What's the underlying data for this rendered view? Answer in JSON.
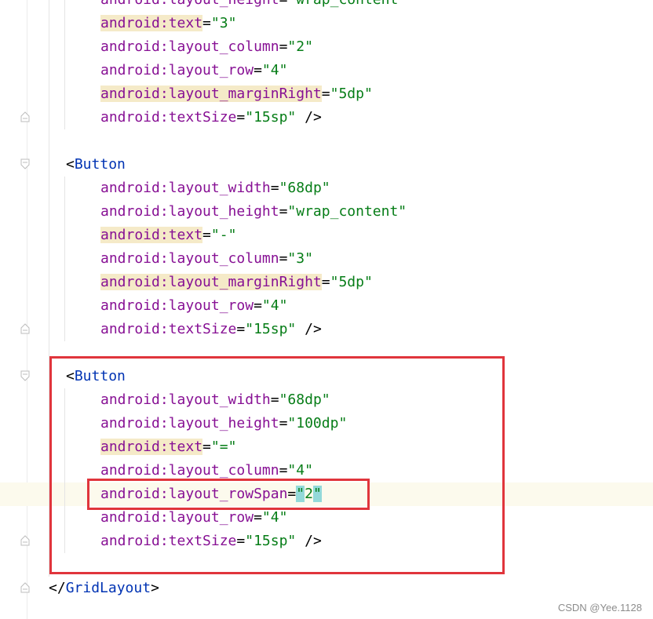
{
  "editor": {
    "lines": [
      {
        "attr": "android:layout_height",
        "val": "\"wrap_content\""
      },
      {
        "attr": "android:text",
        "val": "\"3\"",
        "hl": true
      },
      {
        "attr": "android:layout_column",
        "val": "\"2\""
      },
      {
        "attr": "android:layout_row",
        "val": "\"4\""
      },
      {
        "attr": "android:layout_marginRight",
        "val": "\"5dp\"",
        "hl": true
      },
      {
        "attr": "android:textSize",
        "val": "\"15sp\"",
        "end": " />"
      },
      {
        "tag": "Button"
      },
      {
        "attr": "android:layout_width",
        "val": "\"68dp\""
      },
      {
        "attr": "android:layout_height",
        "val": "\"wrap_content\""
      },
      {
        "attr": "android:text",
        "val": "\"-\"",
        "hl": true
      },
      {
        "attr": "android:layout_column",
        "val": "\"3\""
      },
      {
        "attr": "android:layout_marginRight",
        "val": "\"5dp\"",
        "hl": true
      },
      {
        "attr": "android:layout_row",
        "val": "\"4\""
      },
      {
        "attr": "android:textSize",
        "val": "\"15sp\"",
        "end": " />"
      },
      {
        "tag": "Button"
      },
      {
        "attr": "android:layout_width",
        "val": "\"68dp\""
      },
      {
        "attr": "android:layout_height",
        "val": "\"100dp\""
      },
      {
        "attr": "android:text",
        "val": "\"=\"",
        "hl": true
      },
      {
        "attr": "android:layout_column",
        "val": "\"4\""
      },
      {
        "attr": "android:layout_rowSpan",
        "val": "\"2\"",
        "caret": true
      },
      {
        "attr": "android:layout_row",
        "val": "\"4\""
      },
      {
        "attr": "android:textSize",
        "val": "\"15sp\"",
        "end": " />"
      },
      {
        "closeTag": "GridLayout"
      }
    ]
  },
  "watermark": "CSDN @Yee.1128",
  "colors": {
    "attribute": "#871094",
    "string": "#067d17",
    "tag": "#0033b3",
    "highlight": "#f5eac8",
    "brace_highlight": "#93d9d9",
    "caret_line": "#fcfaed",
    "annotation_box": "#e0353c"
  }
}
